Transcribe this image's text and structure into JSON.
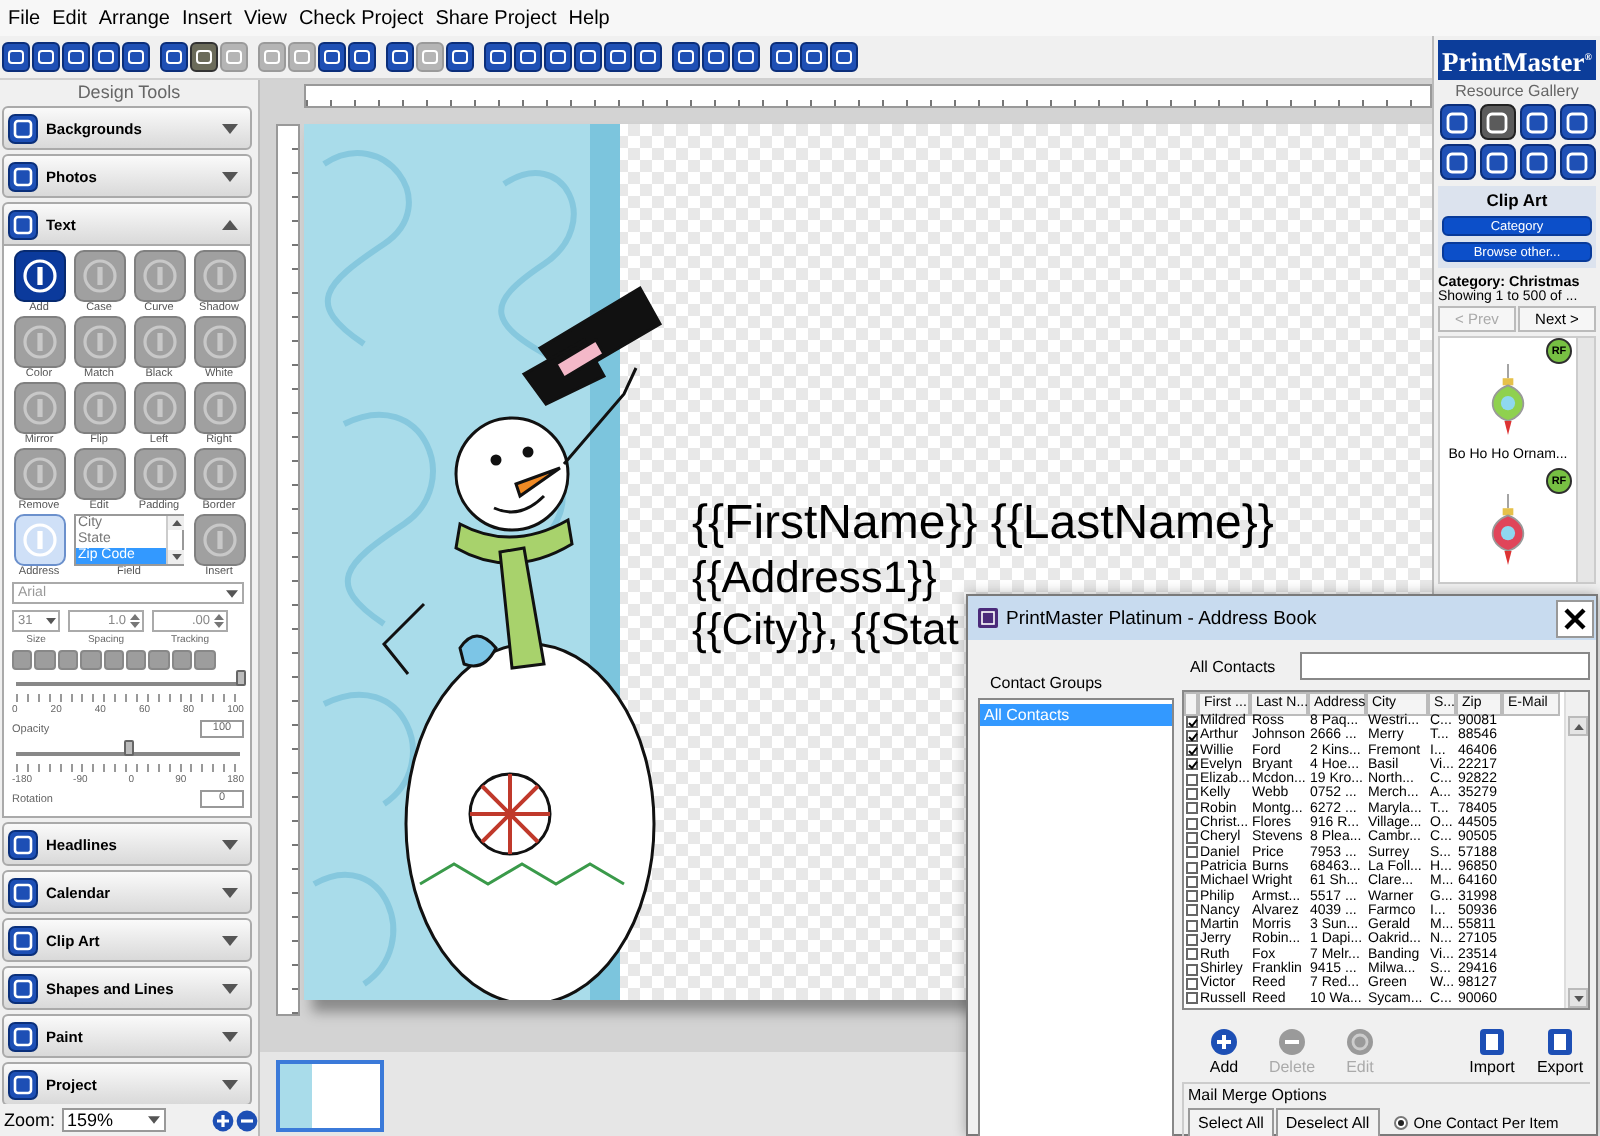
{
  "menu": [
    "File",
    "Edit",
    "Arrange",
    "Insert",
    "View",
    "Check Project",
    "Share Project",
    "Help"
  ],
  "toolbar": [
    [
      {
        "disabled": false,
        "on": false
      },
      {
        "disabled": false,
        "on": false
      },
      {
        "disabled": false,
        "on": false
      },
      {
        "disabled": false,
        "on": false
      },
      {
        "disabled": false,
        "on": false
      }
    ],
    [
      {
        "disabled": false,
        "on": false
      },
      {
        "disabled": false,
        "on": true
      },
      {
        "disabled": true,
        "on": false
      }
    ],
    [
      {
        "disabled": true,
        "on": false
      },
      {
        "disabled": true,
        "on": false
      },
      {
        "disabled": false,
        "on": false
      },
      {
        "disabled": false,
        "on": false
      }
    ],
    [
      {
        "disabled": false,
        "on": false
      },
      {
        "disabled": true,
        "on": false
      },
      {
        "disabled": false,
        "on": false
      }
    ],
    [
      {
        "disabled": false,
        "on": false
      },
      {
        "disabled": false,
        "on": false
      },
      {
        "disabled": false,
        "on": false
      },
      {
        "disabled": false,
        "on": false
      },
      {
        "disabled": false,
        "on": false
      },
      {
        "disabled": false,
        "on": false
      }
    ],
    [
      {
        "disabled": false,
        "on": false
      },
      {
        "disabled": false,
        "on": false
      },
      {
        "disabled": false,
        "on": false
      }
    ],
    [
      {
        "disabled": false,
        "on": false
      },
      {
        "disabled": false,
        "on": false
      },
      {
        "disabled": false,
        "on": false
      }
    ]
  ],
  "design_tools": {
    "title": "Design Tools",
    "sections_before": [
      {
        "label": "Backgrounds",
        "expanded": false
      },
      {
        "label": "Photos",
        "expanded": false
      }
    ],
    "text_section": {
      "label": "Text",
      "expanded": true,
      "tools": [
        {
          "label": "Add",
          "disabled": false
        },
        {
          "label": "Case",
          "disabled": true
        },
        {
          "label": "Curve",
          "disabled": true
        },
        {
          "label": "Shadow",
          "disabled": true
        },
        {
          "label": "Color",
          "disabled": true
        },
        {
          "label": "Match",
          "disabled": true
        },
        {
          "label": "Black",
          "disabled": true
        },
        {
          "label": "White",
          "disabled": true
        },
        {
          "label": "Mirror",
          "disabled": true
        },
        {
          "label": "Flip",
          "disabled": true
        },
        {
          "label": "Left",
          "disabled": true
        },
        {
          "label": "Right",
          "disabled": true
        },
        {
          "label": "Remove",
          "disabled": true
        },
        {
          "label": "Edit",
          "disabled": true
        },
        {
          "label": "Padding",
          "disabled": true
        },
        {
          "label": "Border",
          "disabled": true
        }
      ],
      "address": {
        "label": "Address",
        "disabled": false
      },
      "field": {
        "label": "Field",
        "options": [
          {
            "label": "City",
            "selected": false
          },
          {
            "label": "State",
            "selected": false
          },
          {
            "label": "Zip Code",
            "selected": true
          }
        ]
      },
      "insert": {
        "label": "Insert",
        "disabled": true
      },
      "font": "Arial",
      "size": "31",
      "size_label": "Size",
      "spacing": "1.0",
      "spacing_label": "Spacing",
      "tracking": ".00",
      "tracking_label": "Tracking",
      "opacity": {
        "label": "Opacity",
        "level": 1,
        "ticks": [
          "0",
          "20",
          "40",
          "60",
          "80",
          "100"
        ],
        "value": "100"
      },
      "rotation": {
        "label": "Rotation",
        "level": 0.5,
        "ticks": [
          "-180",
          "-90",
          "0",
          "90",
          "180"
        ],
        "value": "0"
      }
    },
    "sections_after": [
      {
        "label": "Headlines",
        "expanded": false
      },
      {
        "label": "Calendar",
        "expanded": false
      },
      {
        "label": "Clip Art",
        "expanded": false
      },
      {
        "label": "Shapes and Lines",
        "expanded": false
      },
      {
        "label": "Paint",
        "expanded": false
      },
      {
        "label": "Project",
        "expanded": false
      }
    ]
  },
  "zoom": {
    "label": "Zoom:",
    "value": "159%"
  },
  "page": {
    "lines": [
      "{{FirstName}} {{LastName}}",
      "{{Address1}}",
      "{{City}}, {{Stat"
    ]
  },
  "thumbnails": [
    {
      "selected": true
    }
  ],
  "gallery": {
    "brand": "PrintMaster$^{®}$",
    "title": "Resource Gallery",
    "sources": [
      {
        "selected": false
      },
      {
        "selected": true
      },
      {
        "selected": false
      },
      {
        "selected": false
      },
      {
        "selected": false
      },
      {
        "selected": false
      },
      {
        "selected": false
      },
      {
        "selected": false
      }
    ],
    "section": "Clip Art",
    "category_button": "Category",
    "browse_button": "Browse other...",
    "category": "Category: Christmas",
    "showing": "Showing 1 to 500 of ...",
    "prev": {
      "label": "< Prev",
      "disabled": true
    },
    "next": {
      "label": "Next >",
      "disabled": false
    },
    "items": [
      {
        "badge": "RF",
        "caption": "Bo Ho Ho Ornam..."
      },
      {
        "badge": "RF"
      }
    ]
  },
  "address_book": {
    "title": "PrintMaster Platinum - Address Book",
    "groups_label": "Contact Groups",
    "groups": [
      {
        "label": "All Contacts",
        "selected": true
      }
    ],
    "list_label": "All Contacts",
    "columns": [
      "First ...",
      "Last N...",
      "Address",
      "City",
      "S...",
      "Zip",
      "E-Mail"
    ],
    "rows": [
      {
        "checked": true,
        "cells": [
          "Mildred",
          "Ross",
          "8 Paq...",
          "Westri...",
          "C...",
          "90081"
        ]
      },
      {
        "checked": true,
        "cells": [
          "Arthur",
          "Johnson",
          "2666 ...",
          "Merry",
          "T...",
          "88546"
        ]
      },
      {
        "checked": true,
        "cells": [
          "Willie",
          "Ford",
          "2 Kins...",
          "Fremont",
          "I...",
          "46406"
        ]
      },
      {
        "checked": true,
        "cells": [
          "Evelyn",
          "Bryant",
          "4 Hoe...",
          "Basil",
          "Vi...",
          "22217"
        ]
      },
      {
        "checked": false,
        "cells": [
          "Elizab...",
          "Mcdon...",
          "19 Kro...",
          "North...",
          "C...",
          "92822"
        ]
      },
      {
        "checked": false,
        "cells": [
          "Kelly",
          "Webb",
          "0752 ...",
          "Merch...",
          "A...",
          "35279"
        ]
      },
      {
        "checked": false,
        "cells": [
          "Robin",
          "Montg...",
          "6272 ...",
          "Maryla...",
          "T...",
          "78405"
        ]
      },
      {
        "checked": false,
        "cells": [
          "Christ...",
          "Flores",
          "916 R...",
          "Village...",
          "O...",
          "44505"
        ]
      },
      {
        "checked": false,
        "cells": [
          "Cheryl",
          "Stevens",
          "8 Plea...",
          "Cambr...",
          "C...",
          "90505"
        ]
      },
      {
        "checked": false,
        "cells": [
          "Daniel",
          "Price",
          "7953 ...",
          "Surrey",
          "S...",
          "57188"
        ]
      },
      {
        "checked": false,
        "cells": [
          "Patricia",
          "Burns",
          "68463...",
          "La Foll...",
          "H...",
          "96850"
        ]
      },
      {
        "checked": false,
        "cells": [
          "Michael",
          "Wright",
          "61 Sh...",
          "Clare...",
          "M...",
          "64160"
        ]
      },
      {
        "checked": false,
        "cells": [
          "Philip",
          "Armst...",
          "5517 ...",
          "Warner",
          "G...",
          "31998"
        ]
      },
      {
        "checked": false,
        "cells": [
          "Nancy",
          "Alvarez",
          "4039 ...",
          "Farmco",
          "I...",
          "50936"
        ]
      },
      {
        "checked": false,
        "cells": [
          "Martin",
          "Morris",
          "3 Sun...",
          "Gerald",
          "M...",
          "55811"
        ]
      },
      {
        "checked": false,
        "cells": [
          "Jerry",
          "Robin...",
          "1 Dapi...",
          "Oakrid...",
          "N...",
          "27105"
        ]
      },
      {
        "checked": false,
        "cells": [
          "Ruth",
          "Fox",
          "7 Melr...",
          "Banding",
          "Vi...",
          "23514"
        ]
      },
      {
        "checked": false,
        "cells": [
          "Shirley",
          "Franklin",
          "9415 ...",
          "Milwa...",
          "S...",
          "29416"
        ]
      },
      {
        "checked": false,
        "cells": [
          "Victor",
          "Reed",
          "7 Red...",
          "Green",
          "W...",
          "98127"
        ]
      },
      {
        "checked": false,
        "cells": [
          "Russell",
          "Reed",
          "10 Wa...",
          "Sycam...",
          "C...",
          "90060"
        ]
      }
    ],
    "actions": [
      {
        "label": "Add",
        "disabled": false
      },
      {
        "label": "Delete",
        "disabled": true
      },
      {
        "label": "Edit",
        "disabled": true
      },
      {
        "label": "Import",
        "disabled": false
      },
      {
        "label": "Export",
        "disabled": false
      }
    ],
    "mail_merge": {
      "title": "Mail Merge Options",
      "buttons": [
        "Select All",
        "Deselect All"
      ],
      "options": [
        {
          "label": "One Contact Per Item",
          "selected": true
        }
      ]
    }
  }
}
